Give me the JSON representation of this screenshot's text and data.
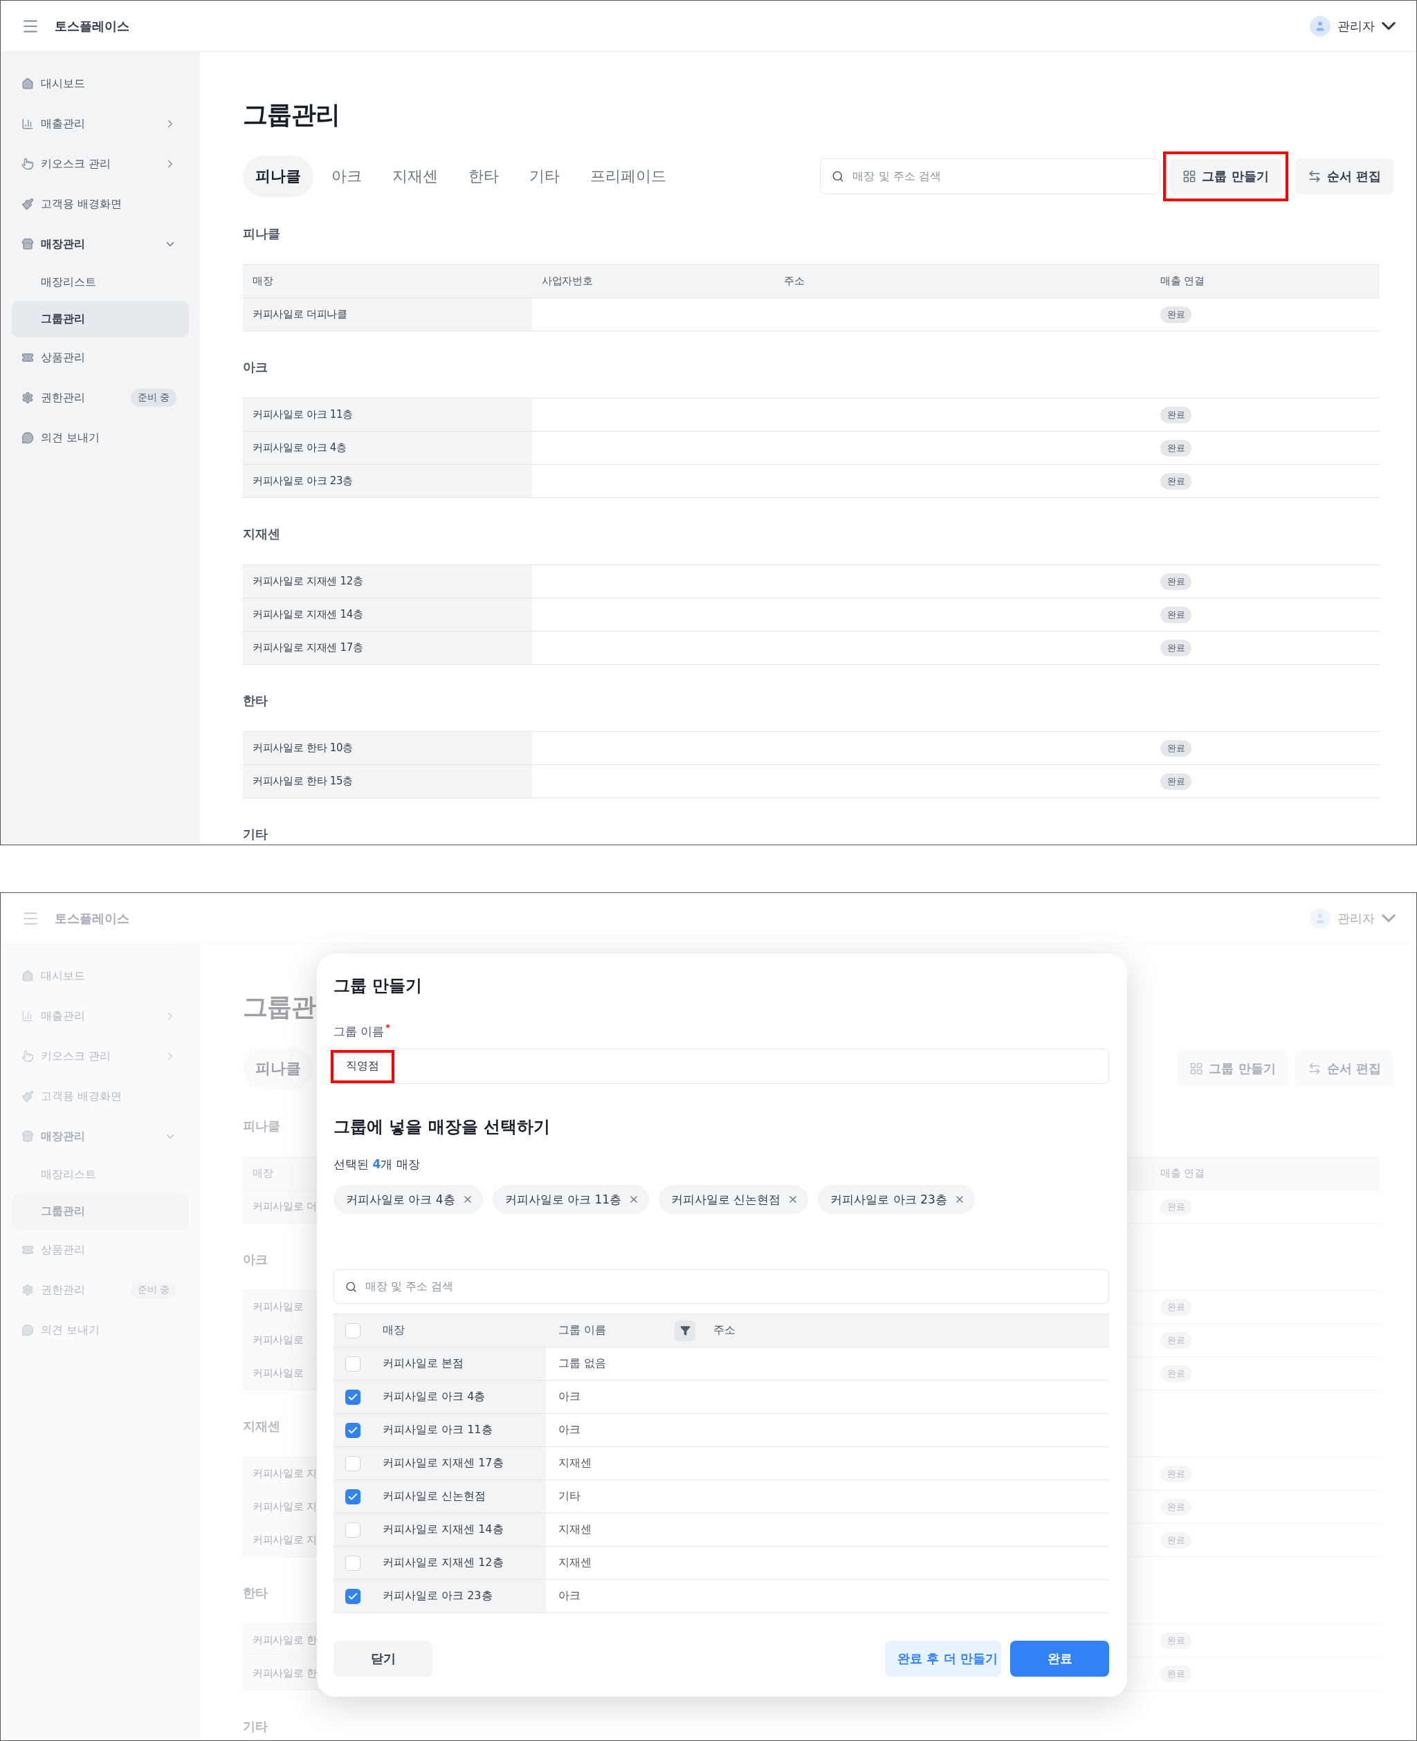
{
  "top_screen": {
    "header": {
      "brand": "토스플레이스",
      "user": "관리자"
    },
    "sidebar": [
      {
        "label": "대시보드"
      },
      {
        "label": "매출관리",
        "expanded": false
      },
      {
        "label": "키오스크 관리",
        "expanded": false
      },
      {
        "label": "고객용 배경화면"
      },
      {
        "label": "매장관리",
        "expanded": true,
        "children": [
          {
            "label": "매장리스트",
            "selected": false
          },
          {
            "label": "그룹관리",
            "selected": true
          }
        ]
      },
      {
        "label": "상품관리"
      },
      {
        "label": "권한관리",
        "badge": "준비 중"
      },
      {
        "label": "의견 보내기"
      }
    ],
    "page_title": "그룹관리",
    "tabs": [
      {
        "label": "피나클",
        "selected": true
      },
      {
        "label": "아크",
        "selected": false
      },
      {
        "label": "지재센",
        "selected": false
      },
      {
        "label": "한타",
        "selected": false
      },
      {
        "label": "기타",
        "selected": false
      },
      {
        "label": "프리페이드",
        "selected": false
      }
    ],
    "search": {
      "placeholder": "매장 및 주소 검색"
    },
    "buttons": [
      {
        "label": "그룹 만들기",
        "kind": "create",
        "highlighted": true
      },
      {
        "label": "순서 편집",
        "kind": "reorder",
        "highlighted": false
      }
    ],
    "groups": [
      {
        "name": "피나클",
        "columns": [
          {
            "label": "매장",
            "kind": "store"
          },
          {
            "label": "사업자번호",
            "kind": "business_no"
          },
          {
            "label": "주소",
            "kind": "address"
          },
          {
            "label": "매출 연결",
            "kind": "sales_link"
          }
        ],
        "rows": [
          {
            "store": "커피사일로 더피나클",
            "status": "완료"
          }
        ]
      },
      {
        "name": "아크",
        "rows": [
          {
            "store": "커피사일로 아크 11층",
            "status": "완료"
          },
          {
            "store": "커피사일로 아크 4층",
            "status": "완료"
          },
          {
            "store": "커피사일로 아크 23층",
            "status": "완료"
          }
        ]
      },
      {
        "name": "지재센",
        "rows": [
          {
            "store": "커피사일로 지재센 12층",
            "status": "완료"
          },
          {
            "store": "커피사일로 지재센 14층",
            "status": "완료"
          },
          {
            "store": "커피사일로 지재센 17층",
            "status": "완료"
          }
        ]
      },
      {
        "name": "한타",
        "rows": [
          {
            "store": "커피사일로 한타 10층",
            "status": "완료"
          },
          {
            "store": "커피사일로 한타 15층",
            "status": "완료"
          }
        ]
      },
      {
        "name": "기타"
      }
    ]
  },
  "bottom_screen": {
    "header": {
      "brand": "토스플레이스",
      "user": "관리자"
    },
    "sidebar": [
      {
        "label": "대시보드"
      },
      {
        "label": "매출관리",
        "expanded": false
      },
      {
        "label": "키오스크 관리",
        "expanded": false
      },
      {
        "label": "고객용 배경화면"
      },
      {
        "label": "매장관리",
        "expanded": true,
        "children": [
          {
            "label": "매장리스트",
            "selected": false
          },
          {
            "label": "그룹관리",
            "selected": true
          }
        ]
      },
      {
        "label": "상품관리"
      },
      {
        "label": "권한관리",
        "badge": "준비 중"
      },
      {
        "label": "의견 보내기"
      }
    ],
    "page_title": "그룹관",
    "tabs": [
      {
        "label": "피나클",
        "selected": true
      }
    ],
    "buttons": [
      {
        "label": "그룹 만들기",
        "kind": "create",
        "highlighted": false
      },
      {
        "label": "순서 편집",
        "kind": "reorder",
        "highlighted": false
      }
    ],
    "groups": [
      {
        "name": "피나클",
        "columns": [
          {
            "label": "매장",
            "kind": "store"
          },
          {
            "label": "매출 연결",
            "kind": "sales_link"
          }
        ],
        "rows": [
          {
            "store": "커피사일로 더",
            "status": "완료"
          }
        ]
      },
      {
        "name": "아크",
        "rows": [
          {
            "store": "커피사일로",
            "status": "완료"
          },
          {
            "store": "커피사일로",
            "status": "완료"
          },
          {
            "store": "커피사일로",
            "status": "완료"
          }
        ]
      },
      {
        "name": "지재센",
        "rows": [
          {
            "store": "커피사일로 지",
            "status": "완료"
          },
          {
            "store": "커피사일로 지",
            "status": "완료"
          },
          {
            "store": "커피사일로 지",
            "status": "완료"
          }
        ]
      },
      {
        "name": "한타",
        "rows": [
          {
            "store": "커피사일로 한",
            "status": "완료"
          },
          {
            "store": "커피사일로 한",
            "status": "완료"
          }
        ]
      },
      {
        "name": "기타"
      }
    ],
    "modal": {
      "title": "그룹 만들기",
      "name_field": {
        "label": "그룹 이름",
        "required": true,
        "value": "직영점",
        "highlighted": true
      },
      "section_title": "그룹에 넣을 매장을 선택하기",
      "selected_summary": "선택된 **4**개 매장",
      "chips": [
        "커피사일로 아크 4층",
        "커피사일로 아크 11층",
        "커피사일로 신논현점",
        "커피사일로 아크 23층"
      ],
      "search": {
        "placeholder": "매장 및 주소 검색"
      },
      "table": {
        "all_checked": false,
        "columns": [
          "매장",
          "그룹 이름",
          "주소"
        ],
        "rows": [
          {
            "store": "커피사일로 본점",
            "group": "그룹 없음",
            "checked": false
          },
          {
            "store": "커피사일로 아크 4층",
            "group": "아크",
            "checked": true
          },
          {
            "store": "커피사일로 아크 11층",
            "group": "아크",
            "checked": true
          },
          {
            "store": "커피사일로 지재센 17층",
            "group": "지재센",
            "checked": false
          },
          {
            "store": "커피사일로 신논현점",
            "group": "기타",
            "checked": true
          },
          {
            "store": "커피사일로 지재센 14층",
            "group": "지재센",
            "checked": false
          },
          {
            "store": "커피사일로 지재센 12층",
            "group": "지재센",
            "checked": false
          },
          {
            "store": "커피사일로 아크 23층",
            "group": "아크",
            "checked": true
          }
        ]
      },
      "buttons": [
        {
          "label": "닫기",
          "kind": "secondary"
        },
        {
          "label": "완료 후 더 만들기",
          "kind": "tinted"
        },
        {
          "label": "완료",
          "kind": "primary"
        }
      ]
    }
  }
}
